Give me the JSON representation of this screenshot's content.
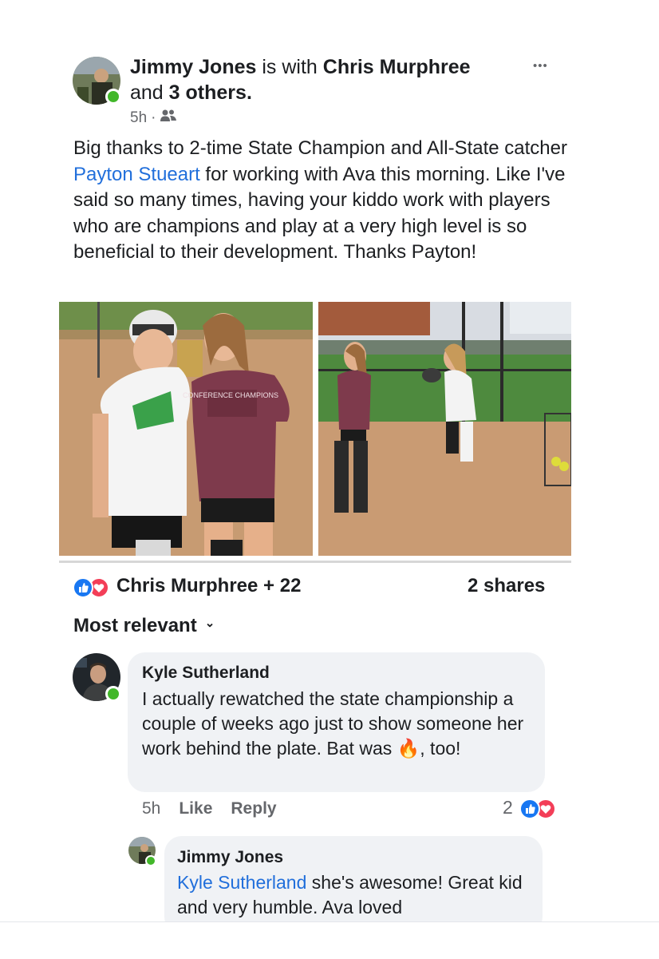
{
  "post": {
    "author": "Jimmy Jones",
    "with_text": " is with ",
    "tagged": "Chris Murphree",
    "and_text": "and ",
    "others": "3 others",
    "period": ".",
    "time": "5h",
    "separator": "·",
    "audience_icon": "friends-icon",
    "more_icon": "•••",
    "text_part1": "Big thanks to 2-time State Champion and All-State catcher ",
    "text_link": "Payton Stueart",
    "text_part2": " for working with Ava this morning. Like I've said so many times, having your kiddo work with players who are champions and play at a very high level is so beneficial to their development. Thanks Payton!",
    "photo_shirt_text": "CONFERENCE CHAMPIONS"
  },
  "reactions": {
    "summary": "Chris Murphree + 22",
    "shares": "2 shares",
    "like_color": "#1877f2",
    "love_color": "#f33e58"
  },
  "sort": {
    "label": "Most relevant",
    "chevron": "⌄"
  },
  "comments": [
    {
      "author": "Kyle Sutherland",
      "text_before": "I actually rewatched the state championship a couple of weeks ago just to show someone her work behind the plate. Bat was ",
      "emoji": "🔥",
      "text_after": ", too!",
      "time": "5h",
      "like": "Like",
      "reply": "Reply",
      "reaction_count": "2"
    },
    {
      "author": "Jimmy Jones",
      "mention": "Kyle Sutherland",
      "text": " she's awesome! Great kid and very humble. Ava loved"
    }
  ]
}
